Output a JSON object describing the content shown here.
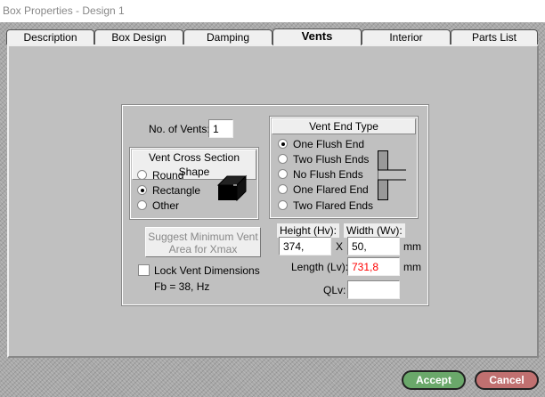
{
  "window": {
    "title": "Box Properties - Design 1"
  },
  "tabs": [
    {
      "label": "Description"
    },
    {
      "label": "Box Design"
    },
    {
      "label": "Damping"
    },
    {
      "label": "Vents"
    },
    {
      "label": "Interior"
    },
    {
      "label": "Parts List"
    }
  ],
  "vents": {
    "no_of_vents_label": "No. of Vents:",
    "no_of_vents": "1",
    "cross_section": {
      "title": "Vent Cross Section Shape",
      "options": [
        "Round",
        "Rectangle",
        "Other"
      ],
      "selected": "Rectangle"
    },
    "end_type": {
      "title": "Vent End Type",
      "options": [
        "One Flush End",
        "Two Flush Ends",
        "No Flush Ends",
        "One Flared End",
        "Two Flared Ends"
      ],
      "selected": "One Flush End"
    },
    "suggest_button": "Suggest Minimum Vent Area for Xmax",
    "lock_label": "Lock Vent Dimensions",
    "lock_checked": false,
    "fb_text": "Fb = 38, Hz",
    "height_label": "Height (Hv):",
    "height": "374,",
    "x_label": "X",
    "width_label": "Width (Wv):",
    "width": "50,",
    "unit": "mm",
    "length_label": "Length (Lv):",
    "length": "731,8",
    "length_color": "#ff0000",
    "qlv_label": "QLv:",
    "qlv": ""
  },
  "buttons": {
    "accept": "Accept",
    "cancel": "Cancel",
    "accept_color": "#6aa86a",
    "cancel_color": "#c07070"
  }
}
